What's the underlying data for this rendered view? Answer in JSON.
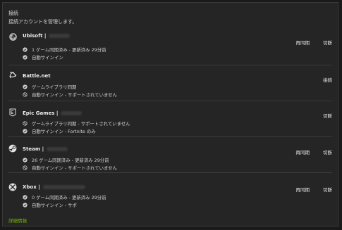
{
  "header": {
    "title": "接続",
    "subtitle": "接続アカウントを管理します。"
  },
  "accounts": [
    {
      "name": "Ubisoft |",
      "icon": "ubisoft-icon",
      "status": [
        {
          "icon": "check-icon",
          "text": "1 ゲーム同期済み - 更新済み 29分前"
        },
        {
          "icon": "check-icon",
          "text": "自動サインイン"
        }
      ],
      "actions": [
        "再同期",
        "切断"
      ]
    },
    {
      "name": "Battle.net",
      "icon": "battlenet-icon",
      "status": [
        {
          "icon": "check-icon",
          "text": "ゲームライブラリ同期"
        },
        {
          "icon": "blocked-icon",
          "text": "自動サインイン - サポートされていません"
        }
      ],
      "actions": [
        "接続"
      ]
    },
    {
      "name": "Epic Games |",
      "icon": "epic-games-icon",
      "status": [
        {
          "icon": "blocked-icon",
          "text": "ゲームライブラリ同期 - サポートされていません"
        },
        {
          "icon": "check-icon",
          "text": "自動サインイン - Fortnite のみ"
        }
      ],
      "actions": [
        "切断"
      ]
    },
    {
      "name": "Steam |",
      "icon": "steam-icon",
      "status": [
        {
          "icon": "check-icon",
          "text": "26 ゲーム同期済み - 更新済み 29分前"
        },
        {
          "icon": "blocked-icon",
          "text": "自動サインイン - サポートされていません"
        }
      ],
      "actions": [
        "再同期",
        "切断"
      ]
    },
    {
      "name": "Xbox |",
      "icon": "xbox-icon",
      "status": [
        {
          "icon": "check-icon",
          "text": "0 ゲーム同期済み - 更新済み 29分前"
        },
        {
          "icon": "check-icon",
          "text": "自動サインイン - サポ"
        }
      ],
      "actions": [
        "再同期",
        "切断"
      ]
    }
  ],
  "footer": {
    "more_link": "詳細情報"
  },
  "colors": {
    "accent": "#76b900",
    "background": "#252525",
    "divider": "#3b3b3b"
  }
}
